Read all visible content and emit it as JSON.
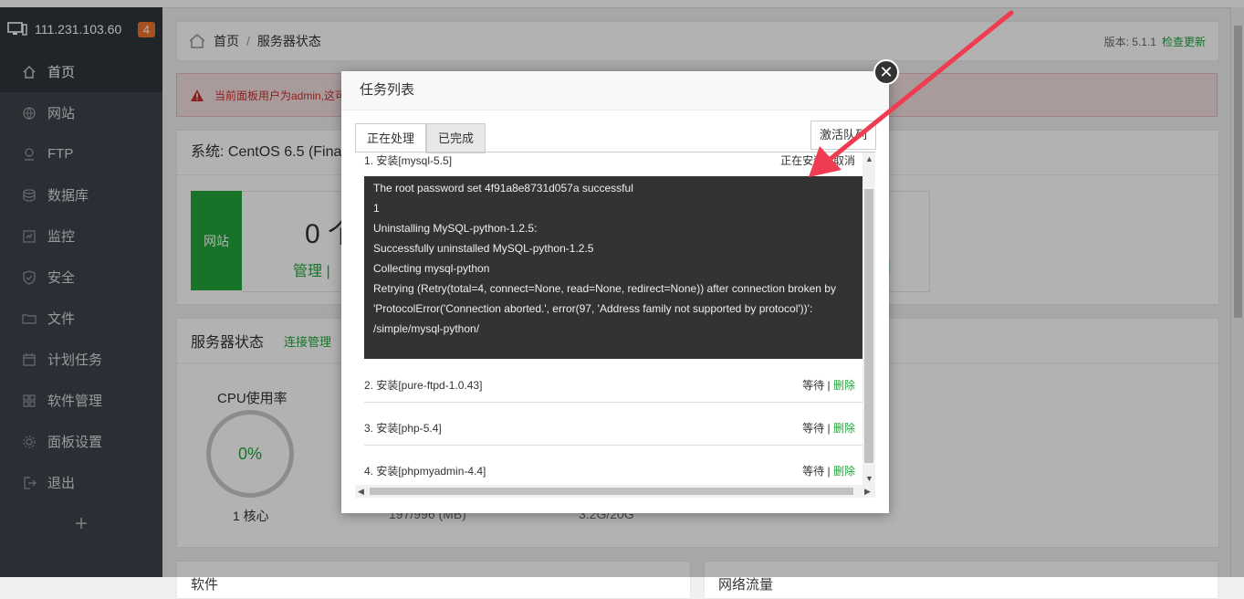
{
  "sidebar": {
    "server_ip": "111.231.103.60",
    "badge": "4",
    "items": [
      {
        "label": "首页",
        "icon": "home-icon"
      },
      {
        "label": "网站",
        "icon": "globe-icon"
      },
      {
        "label": "FTP",
        "icon": "ftp-icon"
      },
      {
        "label": "数据库",
        "icon": "database-icon"
      },
      {
        "label": "监控",
        "icon": "monitor-icon"
      },
      {
        "label": "安全",
        "icon": "shield-icon"
      },
      {
        "label": "文件",
        "icon": "folder-icon"
      },
      {
        "label": "计划任务",
        "icon": "calendar-icon"
      },
      {
        "label": "软件管理",
        "icon": "apps-icon"
      },
      {
        "label": "面板设置",
        "icon": "gear-icon"
      },
      {
        "label": "退出",
        "icon": "logout-icon"
      }
    ],
    "add_label": "+"
  },
  "breadcrumb": {
    "home": "首页",
    "separator": "/",
    "current": "服务器状态",
    "version": "版本: 5.1.1",
    "update_link": "检查更新"
  },
  "alert": {
    "text": "当前面板用户为admin,这可"
  },
  "system": {
    "title": "系统: CentOS 6.5 (Fina",
    "site_box": "网站",
    "count": "0 个",
    "manage": "管理 |",
    "manage2": "]"
  },
  "server_status": {
    "title": "服务器状态",
    "link": "连接管理",
    "cpu_title": "CPU使用率",
    "cpu_value": "0%",
    "cores": "1 核心",
    "memory": "197/996 (MB)",
    "disk": "3.2G/20G"
  },
  "bottom": {
    "left_title": "软件",
    "right_title": "网络流量"
  },
  "modal": {
    "title": "任务列表",
    "tabs": [
      "正在处理",
      "已完成"
    ],
    "activate_button": "激活队列",
    "tasks": [
      {
        "name": "1. 安装[mysql-5.5]",
        "status": "正在安装",
        "action": "取消"
      },
      {
        "name": "2. 安装[pure-ftpd-1.0.43]",
        "status": "等待",
        "action": "删除"
      },
      {
        "name": "3. 安装[php-5.4]",
        "status": "等待",
        "action": "删除"
      },
      {
        "name": "4. 安装[phpmyadmin-4.4]",
        "status": "等待",
        "action": "删除"
      }
    ],
    "log_lines": [
      "The root password set 4f91a8e8731d057a successful",
      "1",
      "Uninstalling MySQL-python-1.2.5:",
      "Successfully uninstalled MySQL-python-1.2.5",
      "Collecting mysql-python",
      "Retrying (Retry(total=4, connect=None, read=None, redirect=None)) after connection broken by",
      "'ProtocolError('Connection aborted.', error(97, 'Address family not supported by protocol'))':",
      "/simple/mysql-python/"
    ]
  },
  "colors": {
    "accent": "#20a53a",
    "sidebar": "#3c444d",
    "badge": "#f0712b",
    "arrow": "#f03c50"
  }
}
